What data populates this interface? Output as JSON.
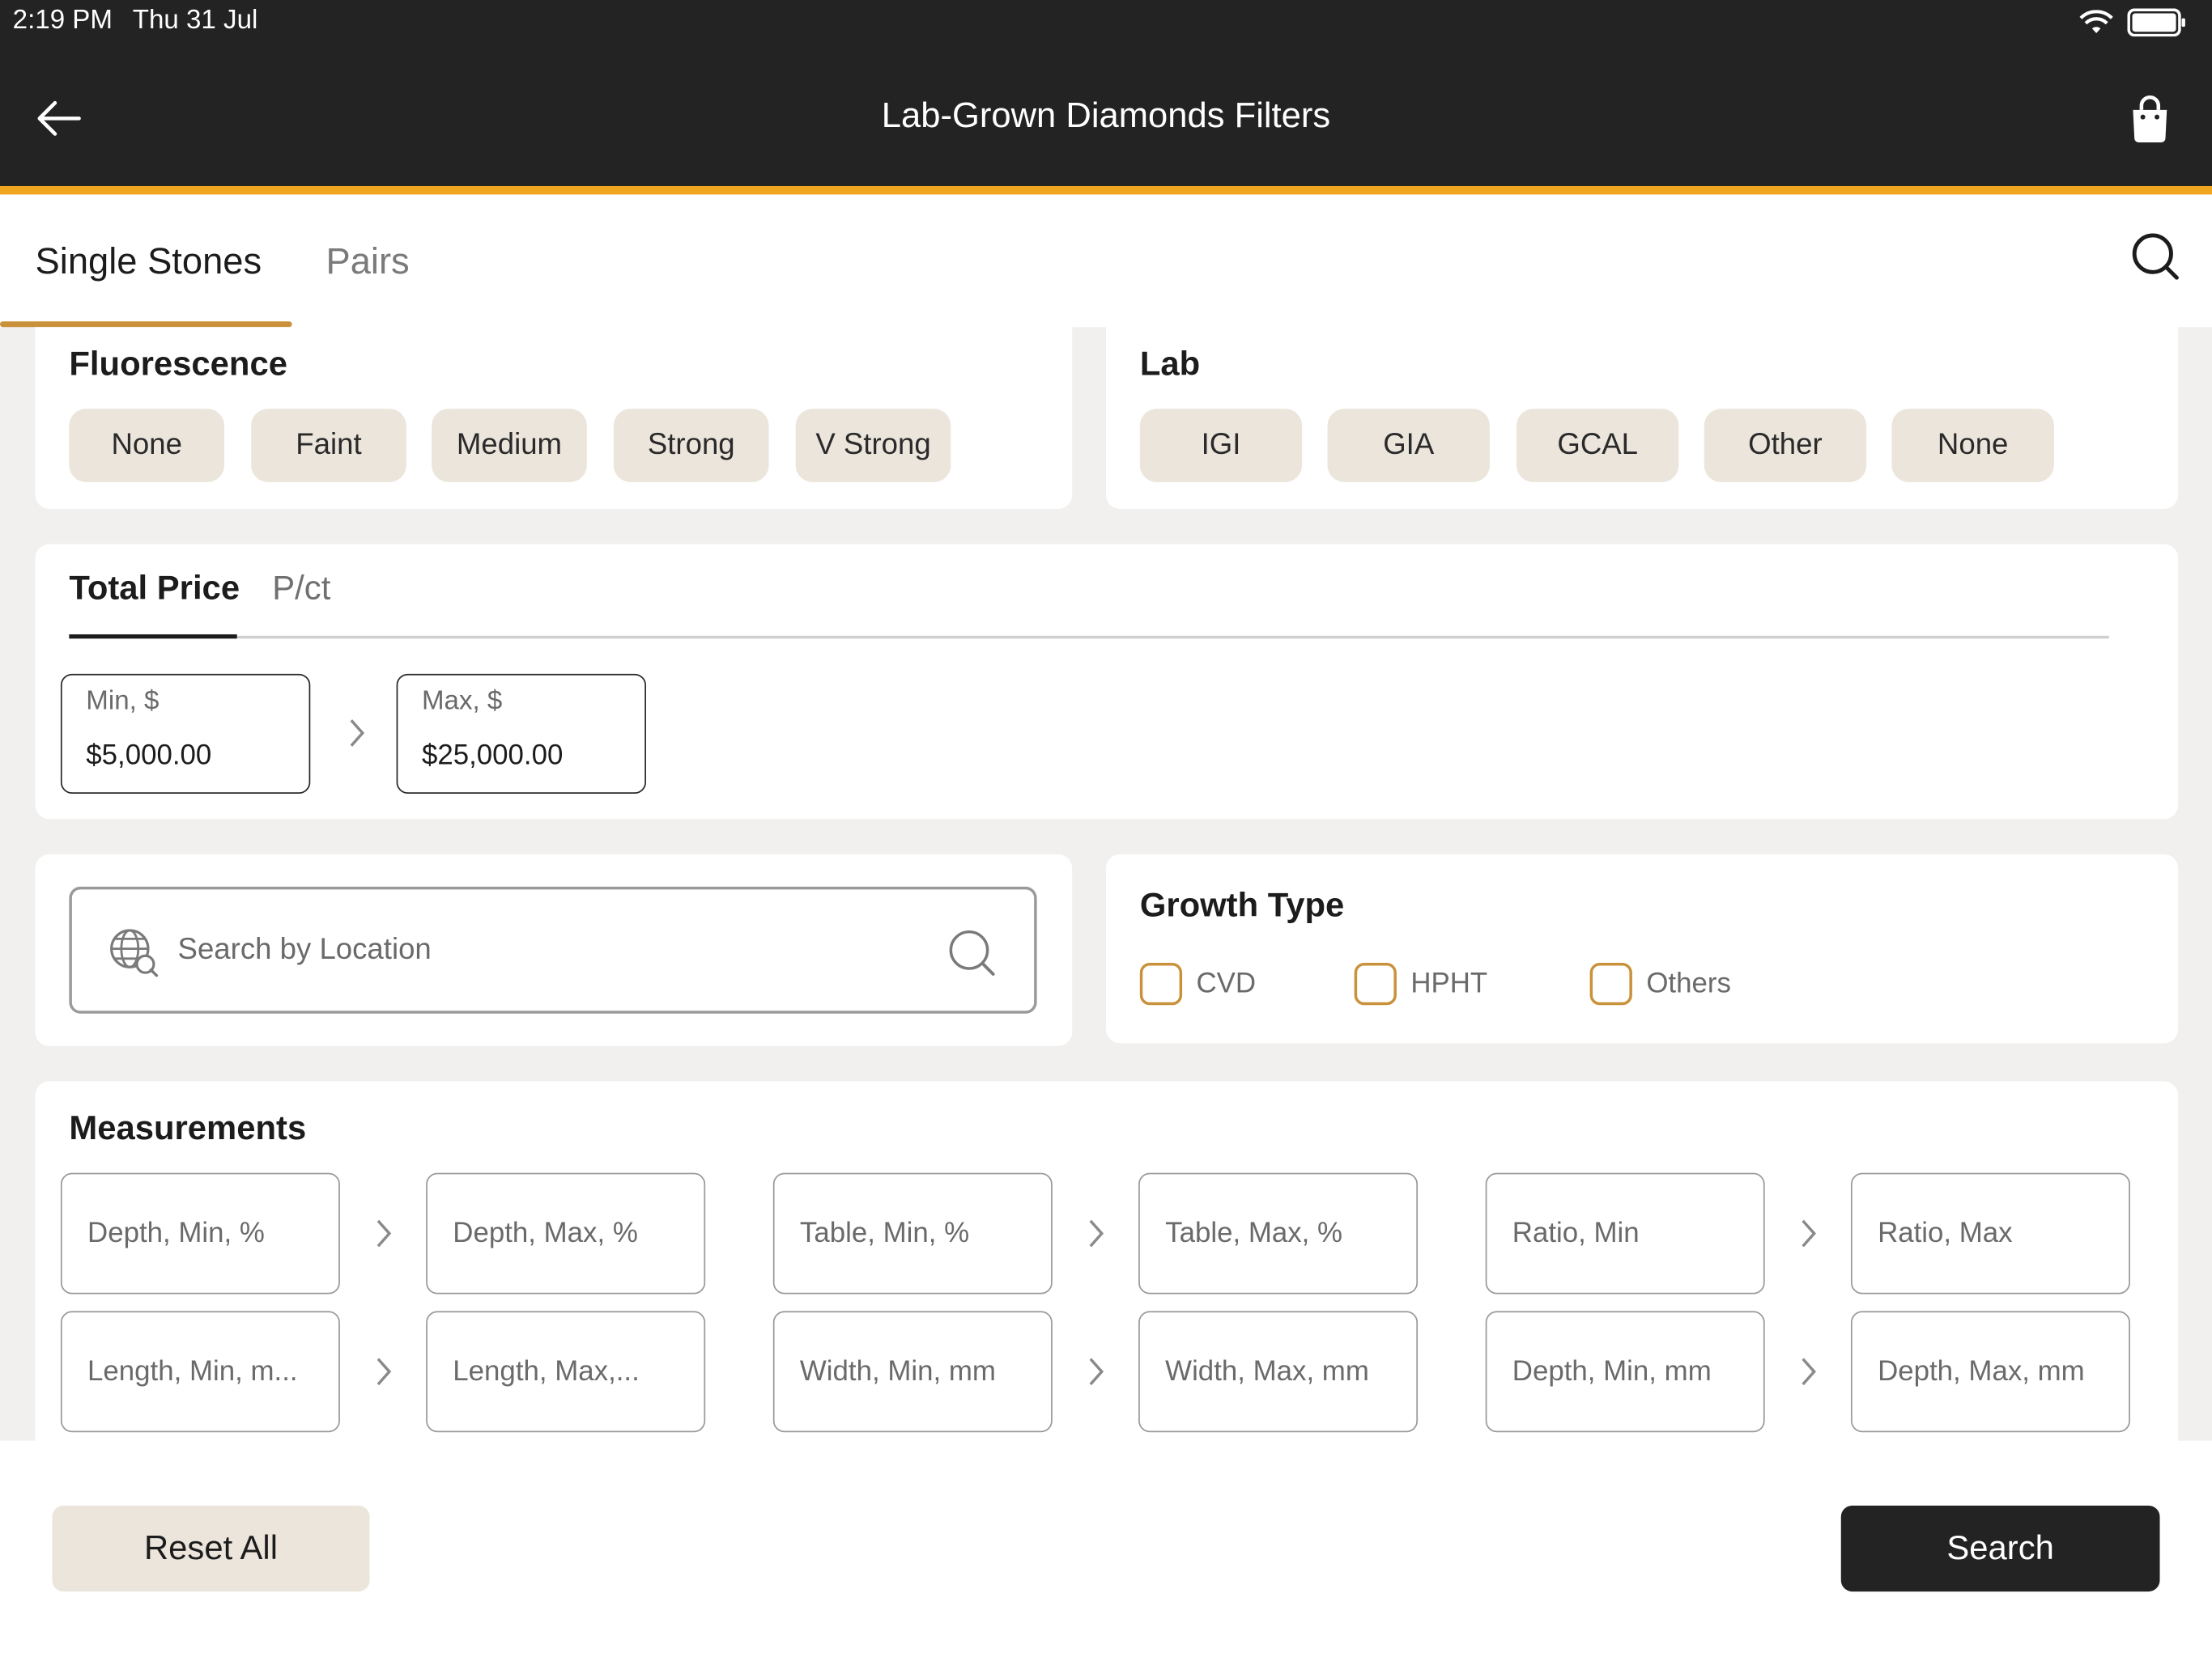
{
  "status_bar": {
    "time": "2:19 PM",
    "date": "Thu 31 Jul",
    "icons": [
      "wifi-icon",
      "battery-icon"
    ]
  },
  "header": {
    "title": "Lab-Grown Diamonds Filters",
    "back_icon": "arrow-left-icon",
    "cart_icon": "shopping-bag-icon"
  },
  "tabs": [
    {
      "label": "Single Stones",
      "active": true
    },
    {
      "label": "Pairs",
      "active": false
    }
  ],
  "fluorescence": {
    "title": "Fluorescence",
    "options": [
      "None",
      "Faint",
      "Medium",
      "Strong",
      "V Strong"
    ]
  },
  "lab": {
    "title": "Lab",
    "options": [
      "IGI",
      "GIA",
      "GCAL",
      "Other",
      "None"
    ]
  },
  "price": {
    "tabs": [
      "Total Price",
      "P/ct"
    ],
    "min_label": "Min, $",
    "min_value": "$5,000.00",
    "max_label": "Max, $",
    "max_value": "$25,000.00"
  },
  "location": {
    "placeholder": "Search by Location"
  },
  "growth_type": {
    "title": "Growth Type",
    "options": [
      "CVD",
      "HPHT",
      "Others"
    ]
  },
  "measurements": {
    "title": "Measurements",
    "fields": [
      "Depth, Min, %",
      "Depth, Max, %",
      "Table, Min, %",
      "Table, Max, %",
      "Ratio, Min",
      "Ratio, Max",
      "Length, Min, m...",
      "Length, Max,...",
      "Width, Min, mm",
      "Width, Max, mm",
      "Depth, Min, mm",
      "Depth, Max, mm"
    ]
  },
  "footer": {
    "reset_label": "Reset All",
    "search_label": "Search"
  },
  "colors": {
    "header_bg": "#232323",
    "accent": "#f0a61e",
    "tab_underline": "#c9923a",
    "chip_bg": "#ebe5dc"
  }
}
